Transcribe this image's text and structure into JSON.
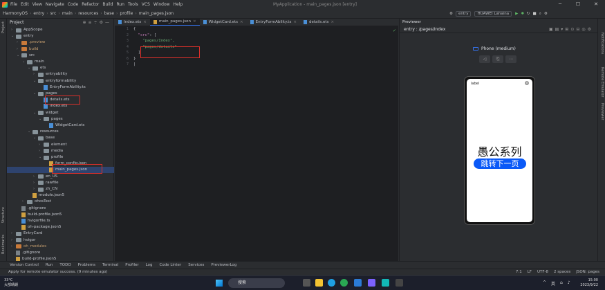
{
  "menubar": {
    "items": [
      "File",
      "Edit",
      "View",
      "Navigate",
      "Code",
      "Refactor",
      "Build",
      "Run",
      "Tools",
      "VCS",
      "Window",
      "Help"
    ],
    "title": "MyApplication - main_pages.json [entry]"
  },
  "navbar": {
    "crumbs": [
      "HarmonyOS",
      "entry",
      "src",
      "main",
      "resources",
      "base",
      "profile",
      "main_pages.json"
    ],
    "run_config": "entry",
    "device": "HUAWEI Lahaina"
  },
  "project_panel": {
    "title": "Project",
    "tree": [
      {
        "label": "AppScope",
        "icon": "folder"
      },
      {
        "label": "entry",
        "icon": "folder"
      },
      {
        "label": ".preview",
        "icon": "folder-orange"
      },
      {
        "label": "build",
        "icon": "folder-orange"
      },
      {
        "label": "src",
        "icon": "folder"
      },
      {
        "label": "main",
        "icon": "folder"
      },
      {
        "label": "ets",
        "icon": "folder"
      },
      {
        "label": "entryability",
        "icon": "folder"
      },
      {
        "label": "entryformability",
        "icon": "folder"
      },
      {
        "label": "EntryFormAbility.ts",
        "icon": "file-ts"
      },
      {
        "label": "pages",
        "icon": "folder"
      },
      {
        "label": "details.ets",
        "icon": "file-ets"
      },
      {
        "label": "Index.ets",
        "icon": "file-ets"
      },
      {
        "label": "widget",
        "icon": "folder"
      },
      {
        "label": "pages",
        "icon": "folder"
      },
      {
        "label": "WidgetCard.ets",
        "icon": "file-ets"
      },
      {
        "label": "resources",
        "icon": "folder"
      },
      {
        "label": "base",
        "icon": "folder"
      },
      {
        "label": "element",
        "icon": "folder"
      },
      {
        "label": "media",
        "icon": "folder"
      },
      {
        "label": "profile",
        "icon": "folder"
      },
      {
        "label": "form_config.json",
        "icon": "file-json"
      },
      {
        "label": "main_pages.json",
        "icon": "file-json"
      },
      {
        "label": "en_US",
        "icon": "folder"
      },
      {
        "label": "rawfile",
        "icon": "folder"
      },
      {
        "label": "zh_CN",
        "icon": "folder"
      },
      {
        "label": "module.json5",
        "icon": "file-json"
      },
      {
        "label": "ohosTest",
        "icon": "folder"
      },
      {
        "label": ".gitignore",
        "icon": "file"
      },
      {
        "label": "build-profile.json5",
        "icon": "file-json"
      },
      {
        "label": "hvigorfile.ts",
        "icon": "file-ts"
      },
      {
        "label": "oh-package.json5",
        "icon": "file-json"
      },
      {
        "label": "EntryCard",
        "icon": "folder"
      },
      {
        "label": "hvigor",
        "icon": "folder"
      },
      {
        "label": "oh_modules",
        "icon": "folder-orange"
      },
      {
        "label": ".gitignore",
        "icon": "file"
      },
      {
        "label": "build-profile.json5",
        "icon": "file-json"
      }
    ]
  },
  "editor": {
    "tabs": [
      "Index.ets",
      "main_pages.json",
      "WidgetCard.ets",
      "EntryFormAbility.ts",
      "details.ets"
    ],
    "active_tab": "main_pages.json",
    "line_numbers": [
      "1",
      "2",
      "3",
      "4",
      "5",
      "6",
      "7"
    ],
    "code": {
      "l1": "{",
      "l2_key": "\"src\"",
      "l2_rest": ": [",
      "l3": "\"pages/Index\",",
      "l4": "\"pages/details\"",
      "l5": "]",
      "l6": "}"
    }
  },
  "previewer": {
    "title": "Previewer",
    "route": "entry : /pages/Index",
    "device": "Phone (medium)",
    "screen_label": "label",
    "big_text": "愚公系列",
    "button_text": "跳转下一页"
  },
  "left_strip": {
    "project": "Project",
    "structure": "Structure",
    "bookmarks": "Bookmarks"
  },
  "right_strip": {
    "notifications": "Notifications",
    "remote": "Remote Emulator",
    "previewer": "Previewer"
  },
  "bottom_tabs": [
    "Version Control",
    "Run",
    "TODO",
    "Problems",
    "Terminal",
    "Profiler",
    "Log",
    "Code Linter",
    "Services",
    "PreviewerLog"
  ],
  "status": {
    "message": "Apply for remote emulator success. (9 minutes ago)",
    "right": [
      "7:1",
      "LF",
      "UTF-8",
      "2 spaces",
      "JSON: pages"
    ]
  },
  "taskbar": {
    "temp": "33°C",
    "weather": "大部晴朗",
    "search": "搜索",
    "lang": "英",
    "time": "15:00",
    "date": "2023/9/22"
  },
  "colors": {
    "accent": "#3574f0",
    "highlight_box": "#e0302a",
    "button": "#0a59f7"
  }
}
